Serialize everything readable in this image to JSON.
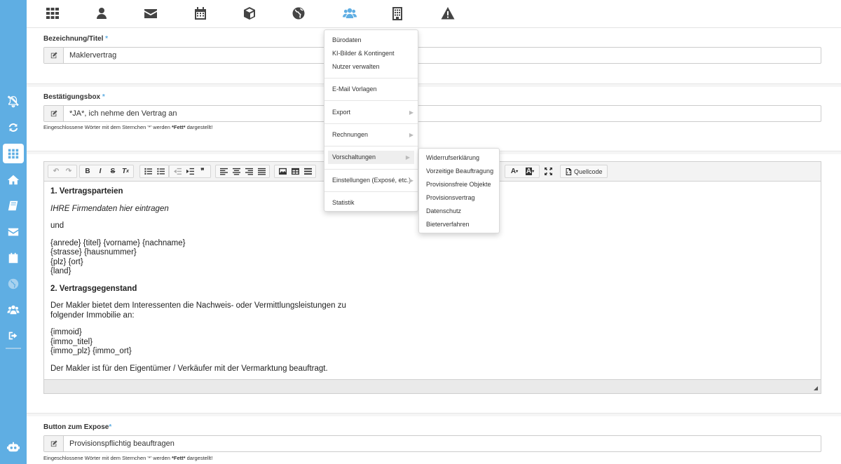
{
  "sidebar": {
    "items": [
      {
        "icon": "bell-slash-icon"
      },
      {
        "icon": "refresh-icon"
      },
      {
        "icon": "grid-icon"
      },
      {
        "icon": "home-icon"
      },
      {
        "icon": "book-icon"
      },
      {
        "icon": "envelope-icon"
      },
      {
        "icon": "calendar-icon"
      },
      {
        "icon": "globe-icon"
      },
      {
        "icon": "users-icon"
      },
      {
        "icon": "logout-icon"
      },
      {
        "icon": "robot-icon"
      }
    ]
  },
  "topnav": {
    "items": [
      {
        "icon": "grid-icon"
      },
      {
        "icon": "user-icon"
      },
      {
        "icon": "envelope-icon"
      },
      {
        "icon": "calendar-icon"
      },
      {
        "icon": "cube-icon"
      },
      {
        "icon": "globe-icon"
      },
      {
        "icon": "users-icon",
        "active": true
      },
      {
        "icon": "building-icon"
      },
      {
        "icon": "warning-icon"
      }
    ]
  },
  "form": {
    "title_label": "Bezeichnung/Titel",
    "title_value": "Maklervertrag",
    "confirm_label": "Bestätigungsbox",
    "confirm_value": "*JA*, ich nehme den Vertrag an",
    "hint_pre": "Eingeschlossene Wörter mit dem Sternchen '*' werden ",
    "hint_bold": "*Fett*",
    "hint_post": " dargestellt!",
    "button_label": "Button zum Expose",
    "button_value": "Provisionspflichtig beauftragen",
    "required_mark": "*"
  },
  "editor": {
    "source_label": "Quellcode",
    "content": {
      "h1": "1. Vertragsparteien",
      "italic": "IHRE Firmendaten hier eintragen",
      "und": "und",
      "addr1": "{anrede} {titel} {vorname} {nachname}",
      "addr2": "{strasse} {hausnummer}",
      "addr3": "{plz} {ort}",
      "addr4": "{land}",
      "h2": "2. Vertragsgegenstand",
      "p1a": "Der Makler bietet dem Interessenten die Nachweis- oder Vermittlungsleistungen zu",
      "p1b": "folgender Immobilie an:",
      "v1": "{immoid}",
      "v2": "{immo_titel}",
      "v3": "{immo_plz} {immo_ort}",
      "p2": "Der Makler ist für den Eigentümer / Verkäufer mit der Vermarktung beauftragt."
    }
  },
  "menu": {
    "items": [
      "Bürodaten",
      "KI-Bilder & Kontingent",
      "Nutzer verwalten",
      "E-Mail Vorlagen",
      "Export",
      "Rechnungen",
      "Vorschaltungen",
      "Einstellungen (Exposé, etc.)",
      "Statistik"
    ],
    "submenu": [
      "Widerrufserklärung",
      "Vorzeitige Beauftragung",
      "Provisionsfreie Objekte",
      "Provisionsvertrag",
      "Datenschutz",
      "Bieterverfahren"
    ]
  }
}
